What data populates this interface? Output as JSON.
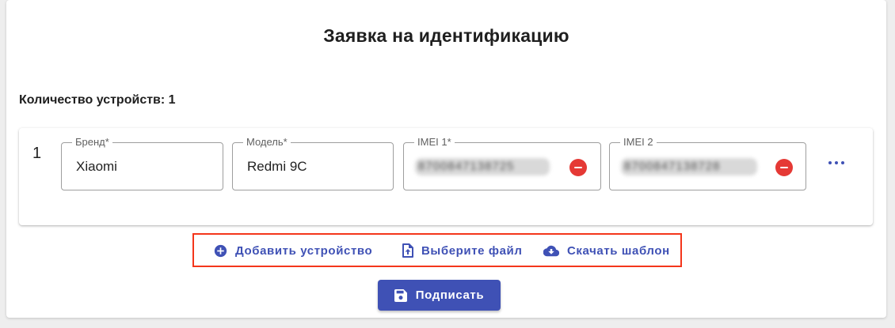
{
  "page": {
    "title": "Заявка на идентификацию",
    "device_count_label": "Количество устройств: 1"
  },
  "device": {
    "index": "1",
    "brand": {
      "label": "Бренд*",
      "value": "Xiaomi"
    },
    "model": {
      "label": "Модель*",
      "value": "Redmi 9C"
    },
    "imei1": {
      "label": "IMEI 1*",
      "value": "8700847138725"
    },
    "imei2": {
      "label": "IMEI 2",
      "value": "8700847138728"
    }
  },
  "actions": {
    "add_device": "Добавить устройство",
    "choose_file": "Выберите файл",
    "download_template": "Скачать шаблон"
  },
  "sign_button": "Подписать",
  "colors": {
    "accent": "#3f51b5",
    "danger": "#e53935",
    "highlight": "#f4361b"
  },
  "icons": {
    "add_device": "plus-circle-icon",
    "choose_file": "file-upload-icon",
    "download_template": "cloud-download-icon",
    "sign": "floppy-disk-icon",
    "more": "more-horizontal-icon",
    "remove": "remove-circle-icon"
  }
}
